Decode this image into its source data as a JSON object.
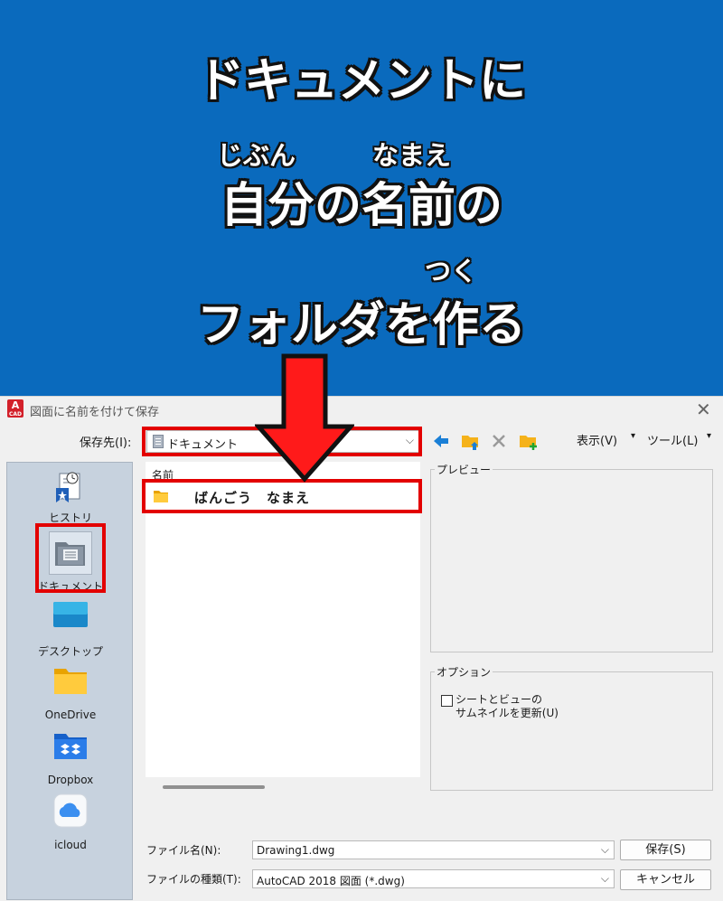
{
  "banner": {
    "line1": "ドキュメントに",
    "ruby1a": "じぶん",
    "ruby1b": "なまえ",
    "line2": "自分の名前の",
    "ruby2": "つく",
    "line3": "フォルダを作る"
  },
  "dialog": {
    "title": "図面に名前を付けて保存",
    "app_icon_letter": "A",
    "app_icon_sub": "CAD",
    "close": "✕",
    "save_in_label": "保存先(I):",
    "save_in_value": "ドキュメント",
    "toolbar": {
      "view_label": "表示(V)",
      "tools_label": "ツール(L)"
    },
    "places": [
      {
        "label": "ヒストリ",
        "icon": "history-icon"
      },
      {
        "label": "ドキュメント",
        "icon": "documents-icon"
      },
      {
        "label": "デスクトップ",
        "icon": "desktop-icon"
      },
      {
        "label": "OneDrive",
        "icon": "folder-icon"
      },
      {
        "label": "Dropbox",
        "icon": "dropbox-icon"
      },
      {
        "label": "icloud",
        "icon": "icloud-icon"
      }
    ],
    "file_list": {
      "column_name": "名前",
      "rows": [
        {
          "name": "ばんごう　なまえ",
          "icon": "folder-icon"
        }
      ]
    },
    "preview_title": "プレビュー",
    "options_title": "オプション",
    "option_checkbox": {
      "line1": "シートとビューの",
      "line2": "サムネイルを更新(U)",
      "checked": false
    },
    "file_name_label": "ファイル名(N):",
    "file_name_value": "Drawing1.dwg",
    "file_type_label": "ファイルの種類(T):",
    "file_type_value": "AutoCAD 2018 図面 (*.dwg)",
    "save_button": "保存(S)",
    "cancel_button": "キャンセル"
  },
  "colors": {
    "banner_bg": "#0a6abd",
    "highlight_red": "#e30000",
    "arrow_red": "#ff1a1a"
  }
}
